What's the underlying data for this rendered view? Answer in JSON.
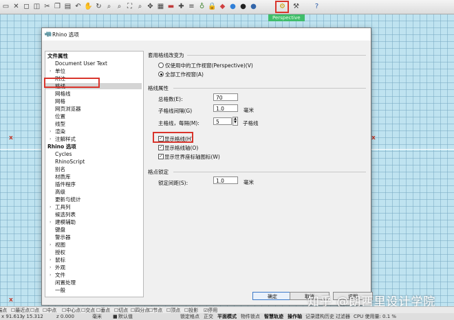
{
  "toolbar": {
    "icons": [
      "new-file-icon",
      "open-file-icon",
      "save-icon",
      "print-icon",
      "cut-icon",
      "copy-icon",
      "paste-icon",
      "undo-icon",
      "pan-icon",
      "rotate-icon",
      "zoom-icon",
      "zoom-window-icon",
      "zoom-extents-icon",
      "zoom-selected-icon",
      "move-icon",
      "grid-icon",
      "car-icon",
      "layer-icon",
      "properties-icon",
      "light-icon",
      "lock-icon",
      "render-icon",
      "shaded-sphere-icon",
      "rendered-sphere-icon",
      "ghost-sphere-icon",
      "tools-icon",
      "options-gear-icon",
      "help-icon"
    ]
  },
  "viewport": {
    "tab_label": "Perspective"
  },
  "dialog": {
    "title": "Rhino 选项",
    "tree": [
      {
        "label": "文件属性",
        "level": 0,
        "bold": true,
        "arrow": false
      },
      {
        "label": "Document User Text",
        "level": 1,
        "arrow": false
      },
      {
        "label": "单位",
        "level": 1,
        "arrow": true
      },
      {
        "label": "附注",
        "level": 1,
        "arrow": false
      },
      {
        "label": "格线",
        "level": 1,
        "arrow": false,
        "selected": true
      },
      {
        "label": "网格线",
        "level": 1,
        "arrow": false
      },
      {
        "label": "网格",
        "level": 1,
        "arrow": false
      },
      {
        "label": "网页浏览器",
        "level": 1,
        "arrow": false
      },
      {
        "label": "位置",
        "level": 1,
        "arrow": false
      },
      {
        "label": "线型",
        "level": 1,
        "arrow": false
      },
      {
        "label": "渲染",
        "level": 1,
        "arrow": true
      },
      {
        "label": "注解样式",
        "level": 1,
        "arrow": true
      },
      {
        "label": "Rhino 选项",
        "level": 0,
        "bold": true,
        "arrow": false
      },
      {
        "label": "Cycles",
        "level": 1,
        "arrow": false
      },
      {
        "label": "RhinoScript",
        "level": 1,
        "arrow": false
      },
      {
        "label": "别名",
        "level": 1,
        "arrow": false
      },
      {
        "label": "材质库",
        "level": 1,
        "arrow": false
      },
      {
        "label": "插件程序",
        "level": 1,
        "arrow": false
      },
      {
        "label": "高级",
        "level": 1,
        "arrow": false
      },
      {
        "label": "更新与统计",
        "level": 1,
        "arrow": false
      },
      {
        "label": "工具列",
        "level": 1,
        "arrow": true
      },
      {
        "label": "候选列表",
        "level": 1,
        "arrow": false
      },
      {
        "label": "建模辅助",
        "level": 1,
        "arrow": true
      },
      {
        "label": "键盘",
        "level": 1,
        "arrow": false
      },
      {
        "label": "警示器",
        "level": 1,
        "arrow": false
      },
      {
        "label": "视图",
        "level": 1,
        "arrow": true
      },
      {
        "label": "授权",
        "level": 1,
        "arrow": false
      },
      {
        "label": "鼠标",
        "level": 1,
        "arrow": true
      },
      {
        "label": "外观",
        "level": 1,
        "arrow": true
      },
      {
        "label": "文件",
        "level": 1,
        "arrow": true
      },
      {
        "label": "闲置处理",
        "level": 1,
        "arrow": false
      },
      {
        "label": "一般",
        "level": 1,
        "arrow": false
      }
    ],
    "apply_section": {
      "heading": "套用格线改变为",
      "option_perspective": "仅使用中的工作视窗(Perspective)(V)",
      "option_all": "全部工作视窗(A)"
    },
    "grid_section": {
      "heading": "格线属性",
      "total_label": "总格数(E):",
      "total_value": "70",
      "spacing_label": "子格线间隔(G)",
      "spacing_value": "1.0",
      "spacing_unit": "毫米",
      "major_label": "主格线，每隔(M):",
      "major_value": "5",
      "major_unit": "子格线",
      "show_grid": "显示格线(H)",
      "show_axes": "显示格线轴(O)",
      "show_world_axes": "显示世界座标轴图标(W)"
    },
    "snap_section": {
      "heading": "格点锁定",
      "snap_label": "锁定间距(S):",
      "snap_value": "1.0",
      "snap_unit": "毫米"
    },
    "buttons": {
      "ok": "确定",
      "cancel": "取消",
      "help": "说明"
    }
  },
  "snapbar": {
    "items": [
      "端点",
      "最近点",
      "点",
      "中点",
      "中心点",
      "交点",
      "垂点",
      "切点",
      "四分点",
      "节点",
      "顶点",
      "投影",
      "停用"
    ]
  },
  "statusbar": {
    "x": "x 91.613",
    "y": "y 15.312",
    "z": "z 0.000",
    "unit": "毫米",
    "layer": "默认值",
    "grid_snap": "锁定格点",
    "ortho": "正交",
    "planar": "平面模式",
    "osnap": "物件锁点",
    "smarttrack": "智慧轨迹",
    "gumball": "操作轴",
    "record_history": "记录建构历史",
    "filter": "过滤器",
    "cpu": "CPU 使用量: 0.1 %"
  },
  "watermark": "知乎 @朗西里设计学院",
  "colors": {
    "highlight_red": "#d9342b",
    "viewport_tab_green": "#3fbd6a",
    "grid_blue": "#bfe3f0"
  }
}
